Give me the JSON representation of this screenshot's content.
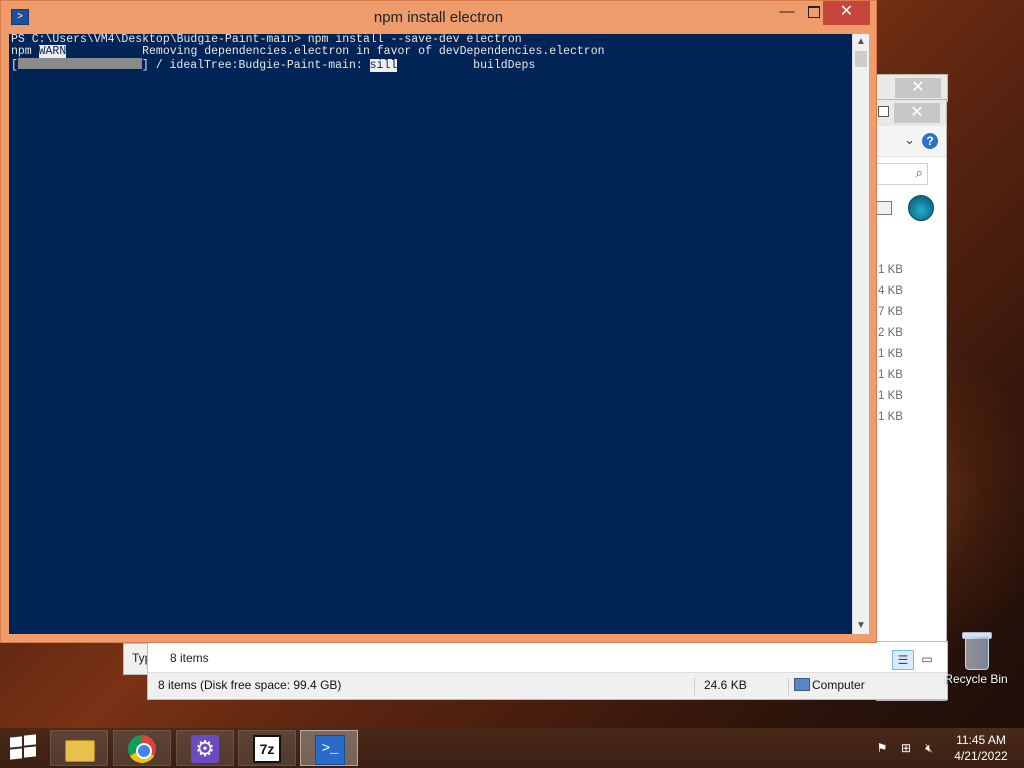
{
  "powershell": {
    "title": "npm install electron",
    "minimize": "—",
    "close": "✕",
    "lines": {
      "l1": "PS C:\\Users\\VM4\\Desktop\\Budgie-Paint-main> npm install --save-dev electron",
      "l2_prefix": "npm ",
      "l2_warn": "WARN",
      "l2_rest": "           Removing dependencies.electron in favor of devDependencies.electron",
      "l3_open": "[",
      "l3_mid": "] / idealTree:Budgie-Paint-main: ",
      "l3_sill": "sill",
      "l3_rest": "           buildDeps"
    }
  },
  "explorer": {
    "close": "✕",
    "chevron": "⌄",
    "help": "?",
    "search_icon": "⌕",
    "sizes": [
      "1 KB",
      "4 KB",
      "7 KB",
      "2 KB",
      "1 KB",
      "1 KB",
      "1 KB",
      "1 KB"
    ],
    "items_count": "8 items",
    "status_left": "8 items (Disk free space: 99.4 GB)",
    "status_size": "24.6 KB",
    "status_location": "Computer"
  },
  "typ_window": {
    "text": "Typ"
  },
  "desktop": {
    "recycle_bin": "Recycle Bin"
  },
  "taskbar": {
    "apps": [
      "File Explorer",
      "Google Chrome",
      "Settings",
      "7-Zip",
      "Windows PowerShell"
    ],
    "sevenz_label": "7z",
    "ps_label": ">_",
    "gear_glyph": "⚙",
    "clock_time": "11:45 AM",
    "clock_date": "4/21/2022"
  },
  "colors": {
    "console_bg": "#012456",
    "window_frame": "#ee9c6c",
    "close_red": "#c7463b"
  }
}
